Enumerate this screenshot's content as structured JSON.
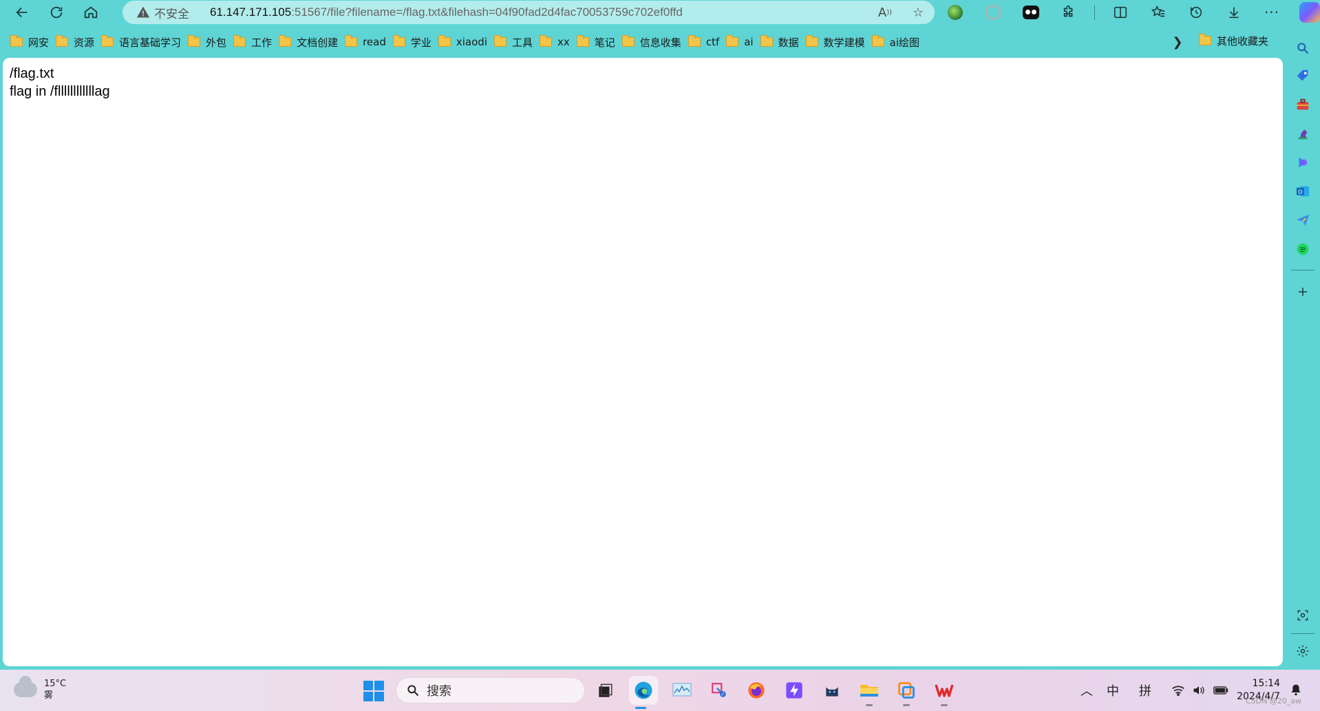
{
  "toolbar": {
    "security_label": "不安全",
    "url_host": "61.147.171.105",
    "url_rest": ":51567/file?filename=/flag.txt&filehash=04f90fad2d4fac70053759c702ef0ffd"
  },
  "bookmarks": [
    {
      "label": "网安"
    },
    {
      "label": "资源"
    },
    {
      "label": "语言基础学习"
    },
    {
      "label": "外包"
    },
    {
      "label": "工作"
    },
    {
      "label": "文档创建"
    },
    {
      "label": "read"
    },
    {
      "label": "学业"
    },
    {
      "label": "xiaodi"
    },
    {
      "label": "工具"
    },
    {
      "label": "xx"
    },
    {
      "label": "笔记"
    },
    {
      "label": "信息收集"
    },
    {
      "label": "ctf"
    },
    {
      "label": "ai"
    },
    {
      "label": "数据"
    },
    {
      "label": "数学建模"
    },
    {
      "label": "ai绘图"
    }
  ],
  "bookmarks_other": "其他收藏夹",
  "page": {
    "line1": "/flag.txt",
    "line2": "flag in /fllllllllllllag"
  },
  "taskbar": {
    "weather_temp": "15°C",
    "weather_desc": "雾",
    "search_placeholder": "搜索",
    "ime_lang": "中",
    "ime_mode": "拼",
    "time": "15:14",
    "date": "2024/4/7",
    "watermark": "CSDN @20_aw"
  },
  "colors": {
    "frame": "#5fd4d4",
    "omnibox": "#b3ecec",
    "folder": "#f3c44a",
    "accent": "#1f8fe8"
  },
  "icons": {
    "toolbar": [
      "back-arrow-icon",
      "refresh-icon",
      "home-icon",
      "warning-icon",
      "read-aloud-icon",
      "favorite-star-icon"
    ],
    "sidebar": [
      "search-icon",
      "tag-icon",
      "briefcase-icon",
      "chess-icon",
      "copilot-icon",
      "outlook-icon",
      "send-icon",
      "spotify-icon",
      "plus-icon",
      "screenshot-icon",
      "settings-icon"
    ]
  }
}
